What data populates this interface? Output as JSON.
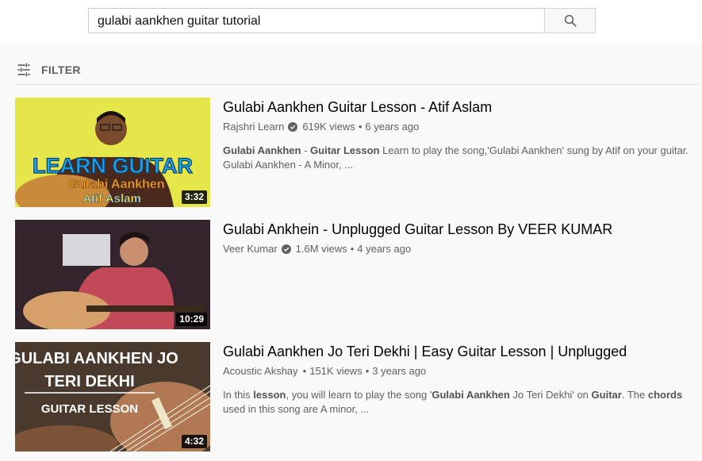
{
  "search": {
    "query": "gulabi aankhen guitar tutorial"
  },
  "filter": {
    "label": "FILTER"
  },
  "results": [
    {
      "title": "Gulabi Aankhen Guitar Lesson - Atif Aslam",
      "channel": "Rajshri Learn",
      "views": "619K views",
      "age": "6 years ago",
      "duration": "3:32",
      "thumb_text": [
        "LEARN GUITAR",
        "Gulabi Aankhen",
        "Atif Aslam"
      ],
      "desc": [
        {
          "t": "Gulabi Aankhen",
          "b": true
        },
        {
          "t": " - ",
          "b": false
        },
        {
          "t": "Guitar Lesson",
          "b": true
        },
        {
          "t": " Learn to play the song,'Gulabi Aankhen' sung by Atif on your guitar. Gulabi Aankhen - A Minor, ...",
          "b": false
        }
      ]
    },
    {
      "title": "Gulabi Ankhein - Unplugged Guitar Lesson By VEER KUMAR",
      "channel": "Veer Kumar",
      "views": "1.6M views",
      "age": "4 years ago",
      "duration": "10:29",
      "desc": []
    },
    {
      "title": "Gulabi Aankhen Jo Teri Dekhi | Easy Guitar Lesson | Unplugged",
      "channel": "Acoustic Akshay",
      "views": "151K views",
      "age": "3 years ago",
      "duration": "4:32",
      "thumb_text": [
        "GULABI AANKHEN JO",
        "TERI DEKHI",
        "GUITAR LESSON"
      ],
      "desc": [
        {
          "t": "In this ",
          "b": false
        },
        {
          "t": "lesson",
          "b": true
        },
        {
          "t": ", you will learn to play the song '",
          "b": false
        },
        {
          "t": "Gulabi Aankhen",
          "b": true
        },
        {
          "t": " Jo Teri Dekhi' on ",
          "b": false
        },
        {
          "t": "Guitar",
          "b": true
        },
        {
          "t": ". The ",
          "b": false
        },
        {
          "t": "chords",
          "b": true
        },
        {
          "t": " used in this song are A minor, ...",
          "b": false
        }
      ]
    }
  ],
  "icons": {
    "search": "search-icon",
    "filter": "filter-sliders-icon",
    "verified": "verified-check-icon"
  },
  "colors": {
    "accent_text": "#030303",
    "meta_text": "#606060",
    "thumb1_bg": "#e4e64a",
    "thumb1_text": "#1fa4e6"
  }
}
